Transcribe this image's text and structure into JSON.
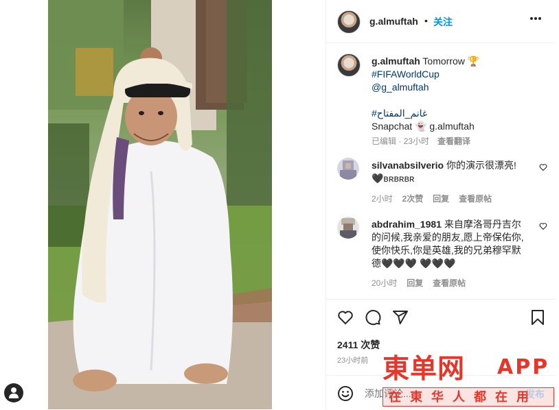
{
  "header": {
    "username": "g.almuftah",
    "separator": "•",
    "follow_label": "关注",
    "more_icon": "more-horizontal-icon"
  },
  "caption": {
    "username": "g.almuftah",
    "line1_text": " Tomorrow 🏆",
    "hashtag1": "#FIFAWorldCup",
    "mention": "@g_almuftah",
    "hashtag2": "#غانم_المفتاح",
    "snapchat": "Snapchat 👻 g.almuftah",
    "edited": "已编辑",
    "dot": " · ",
    "time": "23小时",
    "see_translation": "查看翻译"
  },
  "comments": [
    {
      "username": "silvanabsilverio",
      "text_line1": " 你的演示很漂亮!",
      "text_line2": "🖤ʙʀʙʀʙʀ",
      "time": "2小时",
      "likes": "2次赞",
      "reply": "回复",
      "see_original": "查看原帖"
    },
    {
      "username": "abdrahim_1981",
      "text": " 来自摩洛哥丹吉尔的问候,我亲爱的朋友,愿上帝保佑你,使你快乐,你是英雄,我的兄弟穆罕默德🖤🖤🖤 🖤🖤🖤",
      "time": "20小时",
      "reply": "回复",
      "see_original": "查看原帖"
    }
  ],
  "actions": {
    "like_icon": "heart-icon",
    "comment_icon": "comment-icon",
    "share_icon": "share-icon",
    "save_icon": "bookmark-icon",
    "likes_count": "2411 次赞",
    "posted_time": "23小时前"
  },
  "add_comment": {
    "emoji_icon": "emoji-icon",
    "placeholder": "添加评论...",
    "post_label": "发布"
  },
  "watermark": {
    "brand": "東单网",
    "app": "APP",
    "tagline": "在東华人都在用"
  },
  "colors": {
    "accent": "#0095f6",
    "watermark": "#e8352a",
    "muted": "#8e8e8e"
  }
}
